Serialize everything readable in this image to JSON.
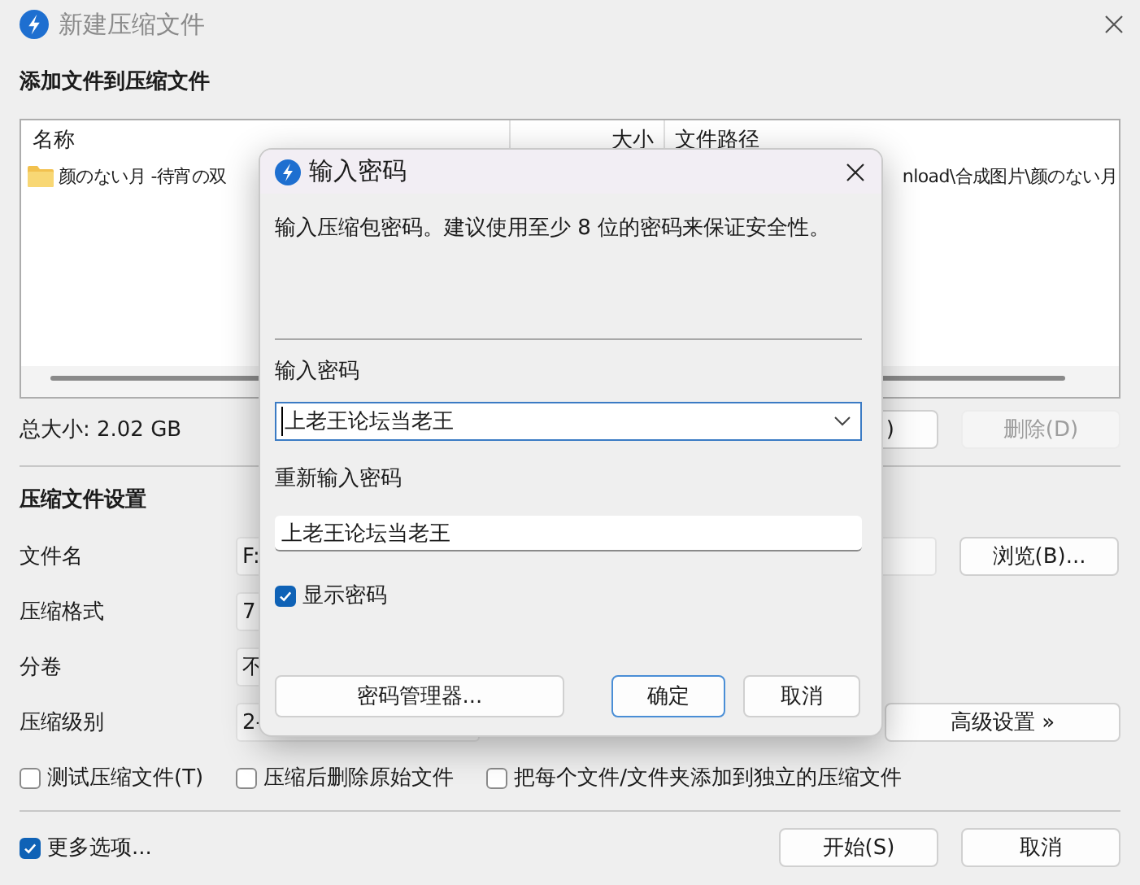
{
  "window": {
    "title": "新建压缩文件"
  },
  "add_section": {
    "heading": "添加文件到压缩文件"
  },
  "file_list": {
    "columns": [
      "名称",
      "大小",
      "文件路径"
    ],
    "rows": [
      {
        "name": "颜のない月 -待宵の双",
        "path": "nload\\合成图片\\颜のない月"
      }
    ]
  },
  "total_size": "总大小: 2.02 GB",
  "list_buttons": [
    {
      "label": ")",
      "disabled": false
    },
    {
      "label": "删除(D)",
      "disabled": true
    }
  ],
  "settings": {
    "heading": "压缩文件设置",
    "rows": [
      {
        "label": "文件名",
        "value": "F:",
        "kind": "wide"
      },
      {
        "label": "压缩格式",
        "value": "7",
        "kind": "short"
      },
      {
        "label": "分卷",
        "value": "不",
        "kind": "short"
      },
      {
        "label": "压缩级别",
        "value": "2-",
        "kind": "short"
      }
    ],
    "browse_button": "浏览(B)...",
    "advanced_button": "高级设置 »"
  },
  "options": [
    {
      "label": "测试压缩文件(T)",
      "checked": false
    },
    {
      "label": "压缩后删除原始文件",
      "checked": false
    },
    {
      "label": "把每个文件/文件夹添加到独立的压缩文件",
      "checked": false
    }
  ],
  "more_options": {
    "label": "更多选项...",
    "checked": true
  },
  "footer_buttons": [
    "开始(S)",
    "取消"
  ],
  "password_dialog": {
    "title": "输入密码",
    "hint": "输入压缩包密码。建议使用至少 8 位的密码来保证安全性。",
    "fields": [
      {
        "label": "输入密码",
        "kind": "combo",
        "value": "上老王论坛当老王",
        "focused": true
      },
      {
        "label": "重新输入密码",
        "kind": "text",
        "value": "上老王论坛当老王",
        "focused": false
      }
    ],
    "show_password": {
      "label": "显示密码",
      "checked": true
    },
    "buttons": [
      {
        "label": "密码管理器...",
        "default": false
      },
      {
        "label": "确定",
        "default": true
      },
      {
        "label": "取消",
        "default": false
      }
    ]
  }
}
